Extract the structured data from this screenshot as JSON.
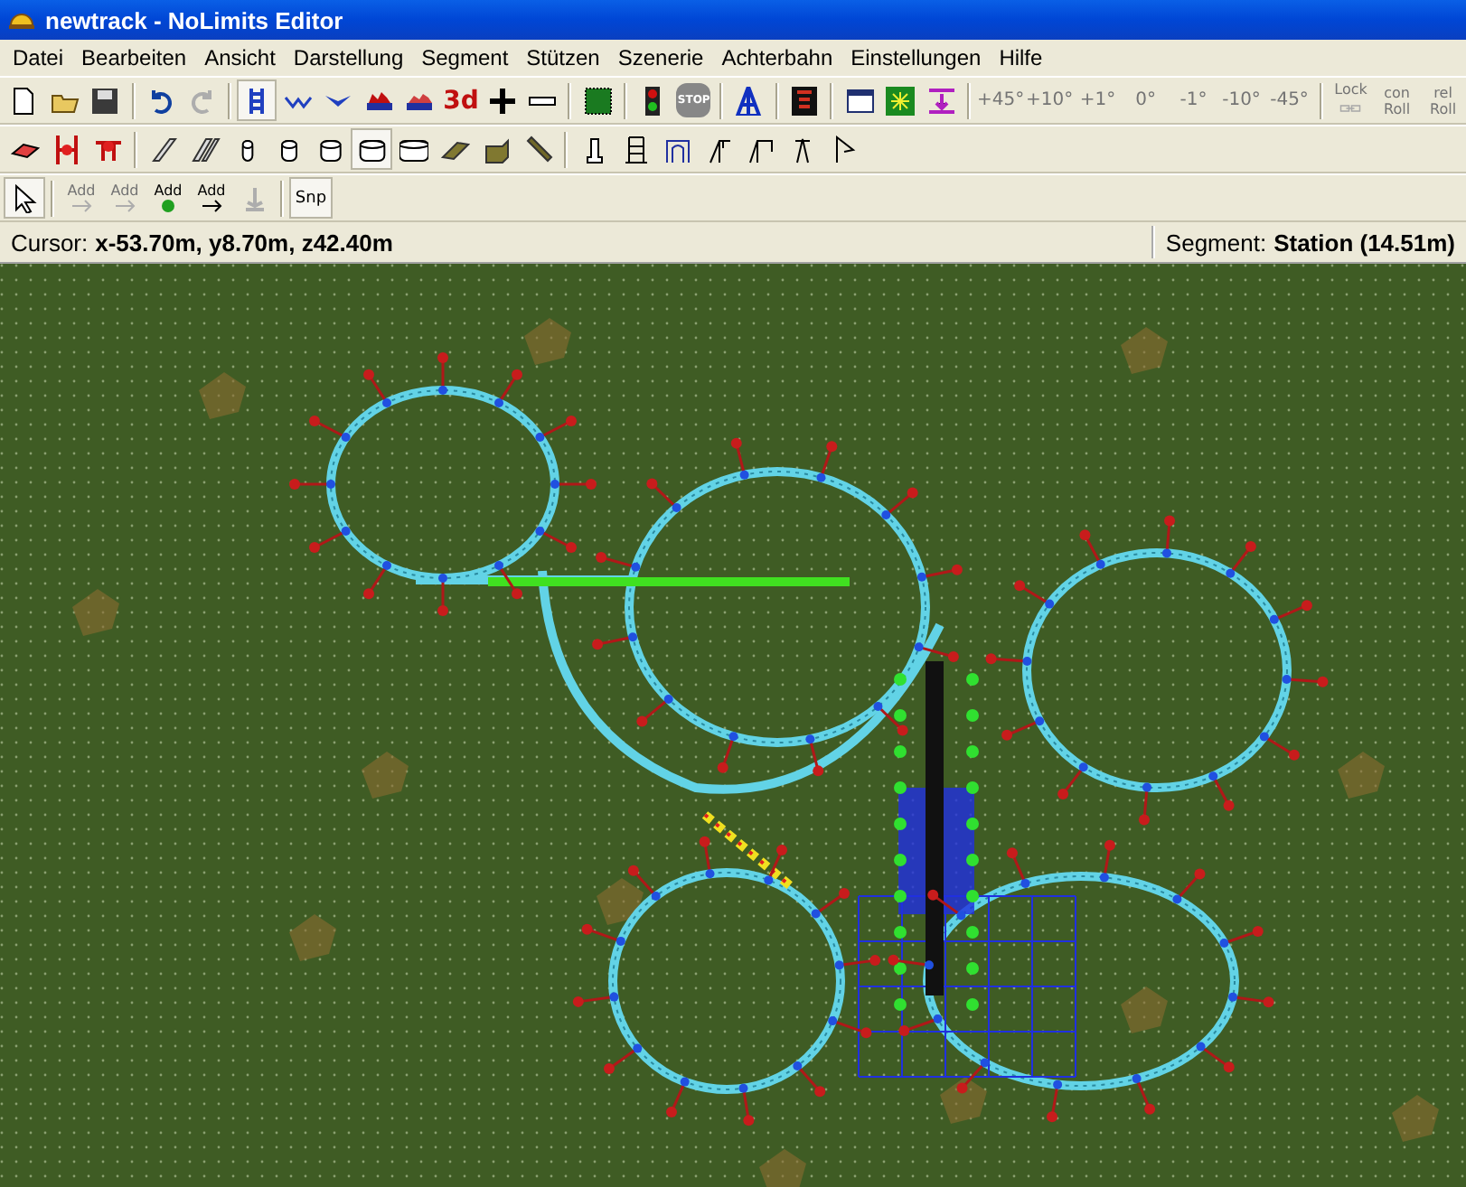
{
  "window": {
    "title": "newtrack - NoLimits Editor"
  },
  "menu": [
    {
      "label": "Datei"
    },
    {
      "label": "Bearbeiten"
    },
    {
      "label": "Ansicht"
    },
    {
      "label": "Darstellung"
    },
    {
      "label": "Segment"
    },
    {
      "label": "Stützen"
    },
    {
      "label": "Szenerie"
    },
    {
      "label": "Achterbahn"
    },
    {
      "label": "Einstellungen"
    },
    {
      "label": "Hilfe"
    }
  ],
  "toolbar_1": {
    "undo": {
      "disabled": false
    },
    "redo": {
      "disabled": true
    },
    "track_mode": {
      "selected": true
    },
    "view_3d": {
      "label": "3d"
    },
    "stop": {
      "label": "STOP",
      "disabled": true
    },
    "angles": [
      {
        "label": "+45°",
        "disabled": true
      },
      {
        "label": "+10°",
        "disabled": true
      },
      {
        "label": "+1°",
        "disabled": true
      },
      {
        "label": "0°",
        "disabled": true
      },
      {
        "label": "-1°",
        "disabled": true
      },
      {
        "label": "-10°",
        "disabled": true
      },
      {
        "label": "-45°",
        "disabled": true
      }
    ],
    "roll": [
      {
        "label": "Lock",
        "disabled": true
      },
      {
        "label": "con Roll",
        "disabled": true
      },
      {
        "label": "rel Roll",
        "disabled": true
      }
    ]
  },
  "toolbar_2": {
    "tube_sizes": [
      {
        "selected": false
      },
      {
        "selected": false
      },
      {
        "selected": false
      },
      {
        "selected": true
      },
      {
        "selected": false
      }
    ]
  },
  "toolbar_3": {
    "select": {
      "selected": true
    },
    "add_buttons": [
      {
        "label": "Add",
        "disabled": true
      },
      {
        "label": "Add",
        "disabled": true
      },
      {
        "label": "Add",
        "disabled": false
      },
      {
        "label": "Add",
        "disabled": false
      }
    ],
    "snap": {
      "label": "Snp",
      "selected": true
    }
  },
  "status_bar": {
    "cursor_label": "Cursor:",
    "cursor_value": "x-53.70m, y8.70m, z42.40m",
    "segment_label": "Segment:",
    "segment_value": "Station (14.51m)"
  }
}
